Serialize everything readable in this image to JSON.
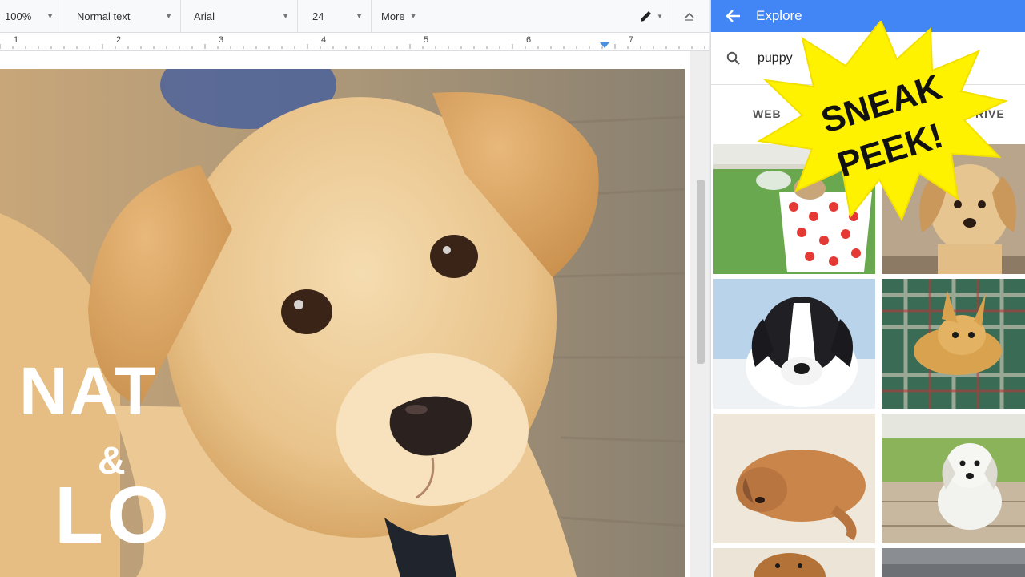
{
  "toolbar": {
    "zoom": "100%",
    "style": "Normal text",
    "font": "Arial",
    "size": "24",
    "more": "More",
    "pencil_icon": "pencil-icon",
    "collapse_icon": "collapse-toolbar-icon"
  },
  "ruler": {
    "numbers": [
      "1",
      "2",
      "3",
      "4",
      "5",
      "6",
      "7"
    ]
  },
  "document": {
    "image_subject": "puppy photo"
  },
  "logo": {
    "line1": "NAT",
    "amp": "&",
    "line2": "LO"
  },
  "explore": {
    "title": "Explore",
    "back_icon": "arrow-left-icon",
    "search_icon": "search-icon",
    "search_value": "puppy",
    "tabs": [
      "WEB",
      "DRIVE"
    ],
    "tab_web_visible": "WEB",
    "tab_drive_visible": "RIVE"
  },
  "sticker": {
    "line1": "SNEAK",
    "line2": "PEEK!"
  },
  "colors": {
    "accent_blue": "#4285f4",
    "burst_yellow": "#fff200"
  }
}
